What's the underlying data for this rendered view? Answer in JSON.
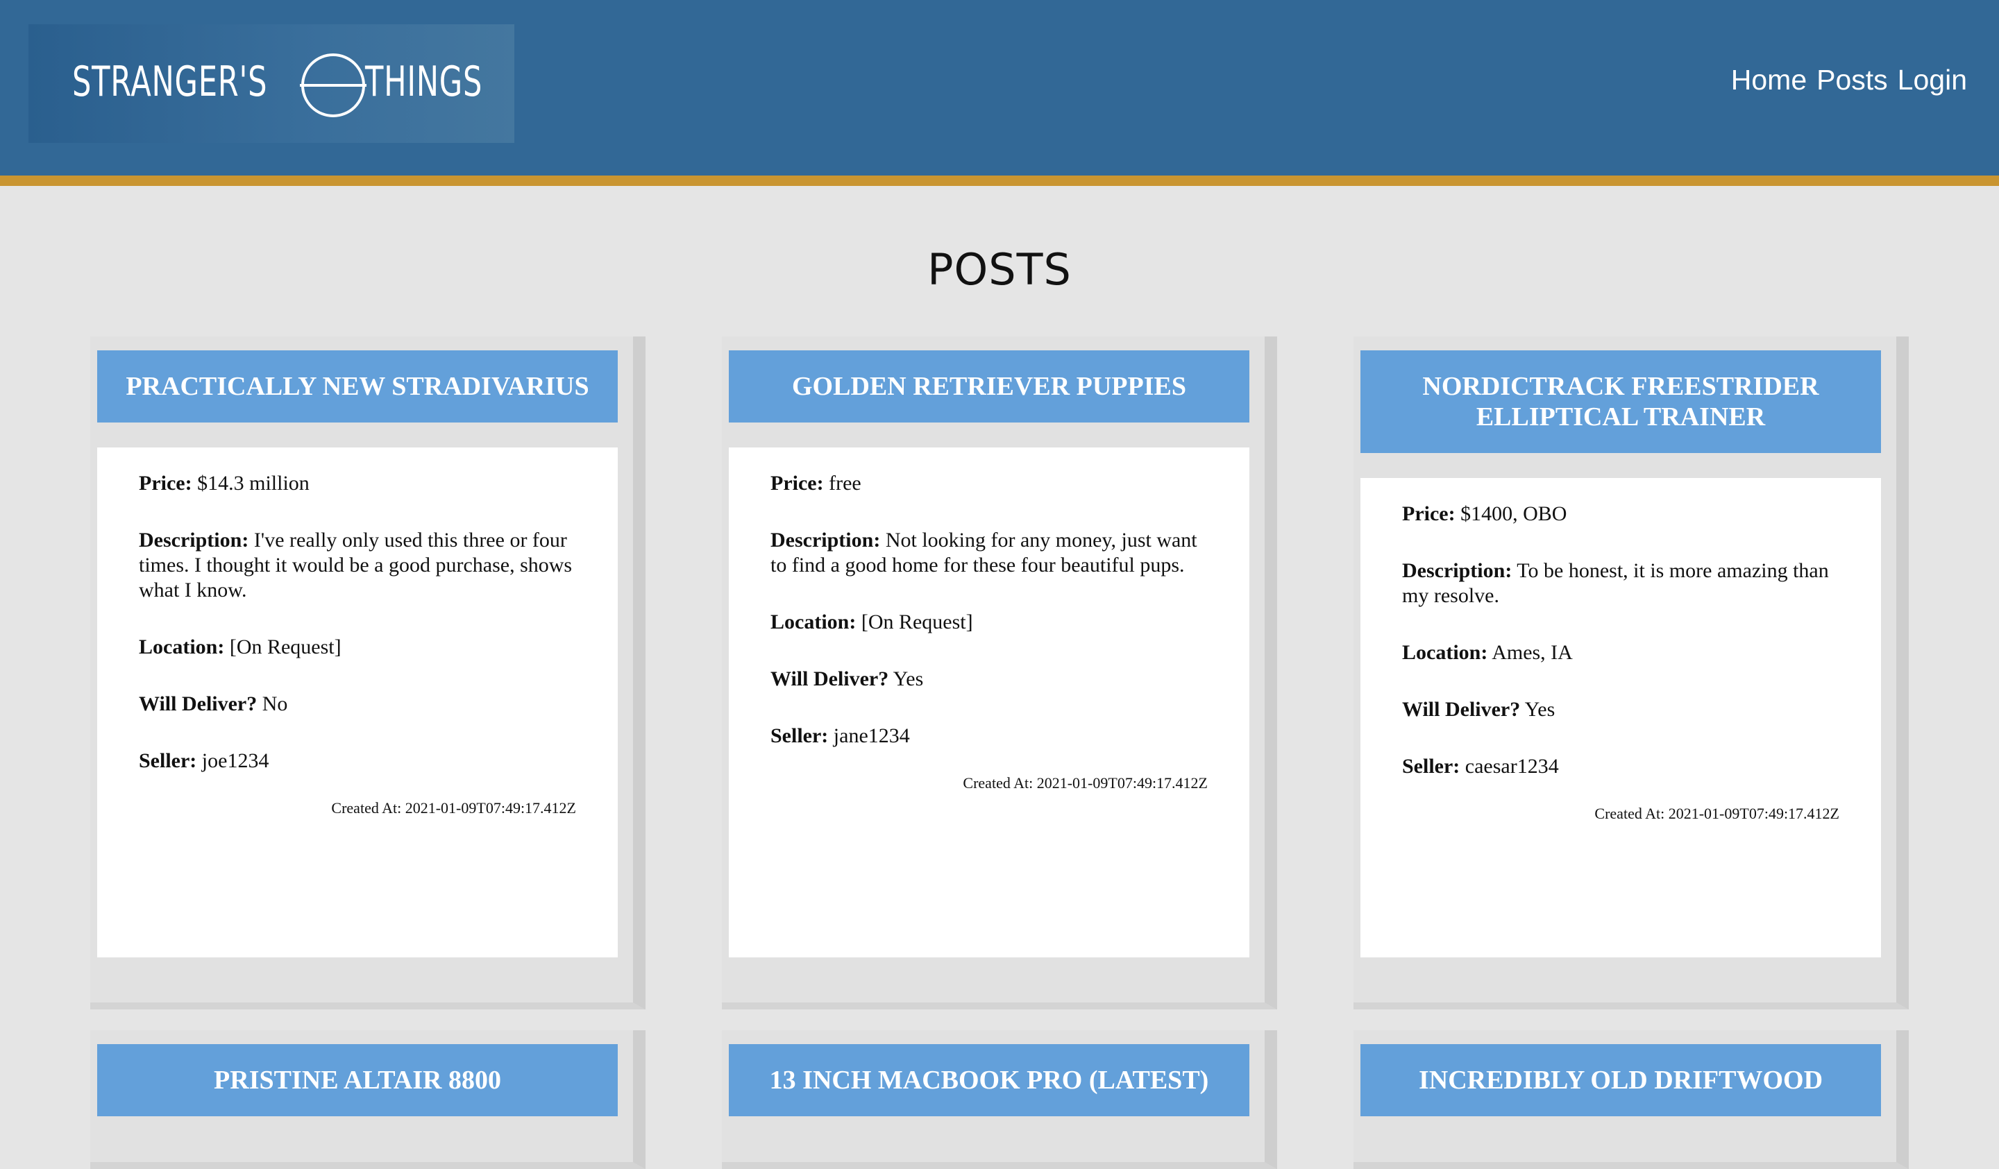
{
  "site": {
    "logo_left": "STRANGER'S",
    "logo_right": "THINGS"
  },
  "nav": {
    "home": "Home",
    "posts": "Posts",
    "login": "Login"
  },
  "page_title": "POSTS",
  "labels": {
    "price": "Price:",
    "description": "Description:",
    "location": "Location:",
    "deliver": "Will Deliver?",
    "seller": "Seller:",
    "created": "Created At:"
  },
  "posts": [
    {
      "title": "PRACTICALLY NEW STRADIVARIUS",
      "price": "$14.3 million",
      "description": "I've really only used this three or four times. I thought it would be a good purchase, shows what I know.",
      "location": "[On Request]",
      "deliver": "No",
      "seller": "joe1234",
      "created": "2021-01-09T07:49:17.412Z"
    },
    {
      "title": "GOLDEN RETRIEVER PUPPIES",
      "price": "free",
      "description": "Not looking for any money, just want to find a good home for these four beautiful pups.",
      "location": "[On Request]",
      "deliver": "Yes",
      "seller": "jane1234",
      "created": "2021-01-09T07:49:17.412Z"
    },
    {
      "title": "NORDICTRACK FREESTRIDER ELLIPTICAL TRAINER",
      "price": "$1400, OBO",
      "description": "To be honest, it is more amazing than my resolve.",
      "location": "Ames, IA",
      "deliver": "Yes",
      "seller": "caesar1234",
      "created": "2021-01-09T07:49:17.412Z"
    },
    {
      "title": "PRISTINE ALTAIR 8800"
    },
    {
      "title": "13 INCH MACBOOK PRO (LATEST)"
    },
    {
      "title": "INCREDIBLY OLD DRIFTWOOD"
    }
  ]
}
